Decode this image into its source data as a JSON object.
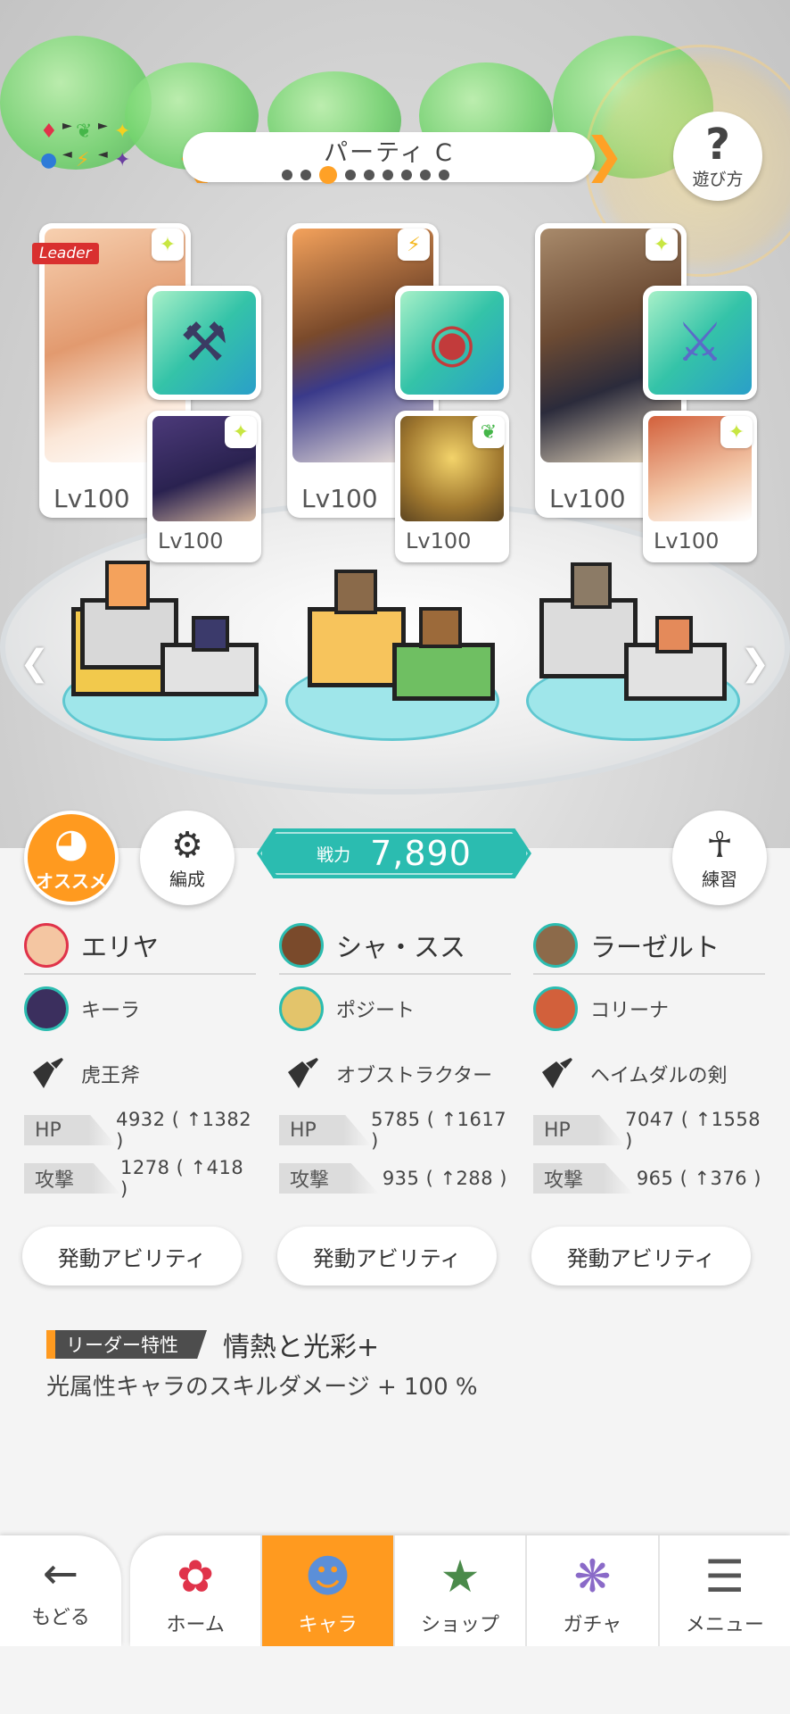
{
  "party": {
    "title": "パーティ C",
    "page_count": 9,
    "active_page": 3
  },
  "help_button": {
    "label": "遊び方"
  },
  "characters": [
    {
      "leader_tag": "Leader",
      "level": "Lv100",
      "element_icon": "sparkle-icon",
      "sub_level": "Lv100",
      "sub_element_icon": "sparkle-icon"
    },
    {
      "level": "Lv100",
      "element_icon": "lightning-icon",
      "sub_level": "Lv100",
      "sub_element_icon": "leaf-icon"
    },
    {
      "level": "Lv100",
      "element_icon": "sparkle-icon",
      "sub_level": "Lv100",
      "sub_element_icon": "sparkle-icon"
    }
  ],
  "buttons": {
    "osusume": "オススメ",
    "hensei": "編成",
    "renshu": "練習"
  },
  "power": {
    "label": "戦力",
    "value": "7,890"
  },
  "columns": [
    {
      "main": "エリヤ",
      "sub": "キーラ",
      "weapon": "虎王斧",
      "hp_label": "HP",
      "hp": "4932 ( ↑1382 )",
      "atk_label": "攻撃",
      "atk": "1278 ( ↑418 )",
      "ability": "発動アビリティ"
    },
    {
      "main": "シャ・スス",
      "sub": "ポジート",
      "weapon": "オブストラクター",
      "hp_label": "HP",
      "hp": "5785 ( ↑1617 )",
      "atk_label": "攻撃",
      "atk": "935 ( ↑288 )",
      "ability": "発動アビリティ"
    },
    {
      "main": "ラーゼルト",
      "sub": "コリーナ",
      "weapon": "ヘイムダルの剣",
      "hp_label": "HP",
      "hp": "7047 ( ↑1558 )",
      "atk_label": "攻撃",
      "atk": "965 ( ↑376 )",
      "ability": "発動アビリティ"
    }
  ],
  "leader_trait": {
    "tag": "リーダー特性",
    "name": "情熱と光彩+",
    "description": "光属性キャラのスキルダメージ + 100 %"
  },
  "nav": {
    "back": "もどる",
    "items": [
      {
        "label": "ホーム",
        "icon": "home-icon"
      },
      {
        "label": "キャラ",
        "icon": "character-icon",
        "active": true
      },
      {
        "label": "ショップ",
        "icon": "shop-icon"
      },
      {
        "label": "ガチャ",
        "icon": "gacha-icon"
      },
      {
        "label": "メニュー",
        "icon": "menu-icon"
      }
    ]
  },
  "colors": {
    "accent_orange": "#ff9a1f",
    "teal": "#2bbcb0",
    "leader_red": "#d9302f"
  }
}
